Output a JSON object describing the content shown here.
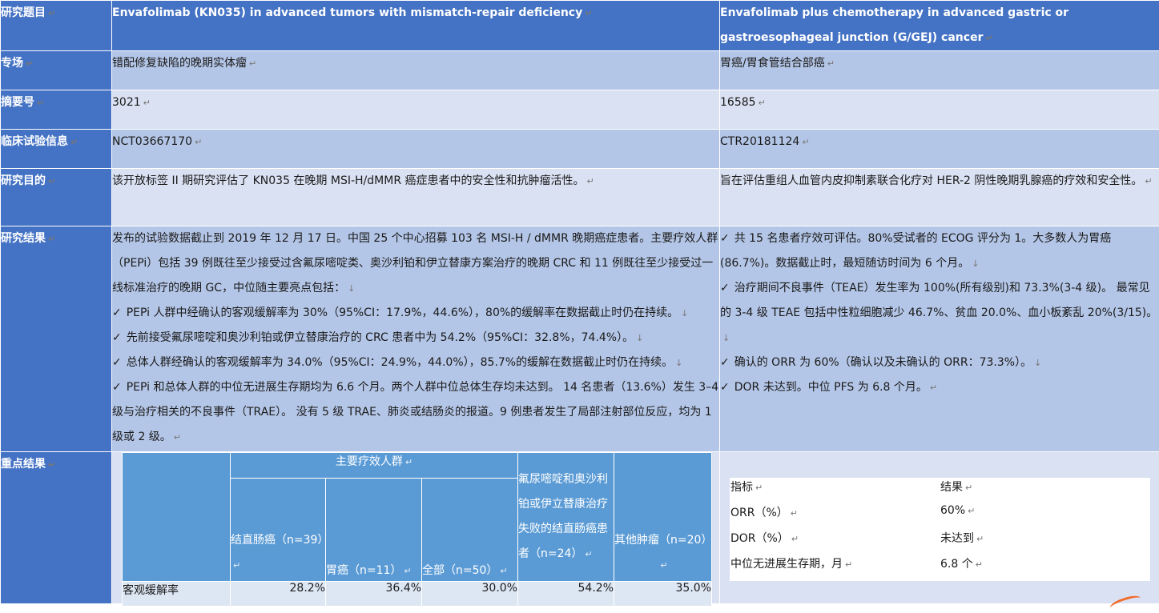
{
  "header": {
    "label": "研究题目",
    "col1": "Envafolimab (KN035) in advanced tumors with mismatch-repair deficiency",
    "col2": "Envafolimab plus chemotherapy in advanced gastric or gastroesophageal junction (G/GEJ) cancer"
  },
  "rows": {
    "specialty": {
      "label": "专场",
      "col1": "错配修复缺陷的晚期实体瘤",
      "col2": "胃癌/胃食管结合部癌"
    },
    "abstract_no": {
      "label": "摘要号",
      "col1": "3021",
      "col2": "16585"
    },
    "trial": {
      "label": "临床试验信息",
      "col1": "NCT03667170",
      "col2": "CTR20181124"
    },
    "purpose": {
      "label": "研究目的",
      "col1": "该开放标签 II 期研究评估了 KN035 在晚期 MSI-H/dMMR 癌症患者中的安全性和抗肿瘤活性。",
      "col2": "旨在评估重组人血管内皮抑制素联合化疗对 HER-2 阴性晚期乳腺癌的疗效和安全性。"
    },
    "results": {
      "label": "研究结果",
      "col1_intro": "发布的试验数据截止到 2019 年 12 月 17 日。中国 25 个中心招募 103 名 MSI-H / dMMR 晚期癌症患者。主要疗效人群（PEPi）包括 39 例既往至少接受过含氟尿嘧啶类、奥沙利铂和伊立替康方案治疗的晚期 CRC 和 11 例既往至少接受过一线标准治疗的晚期 GC，中位随主要亮点包括：",
      "col1_bullets": [
        "PEPi 人群中经确认的客观缓解率为 30%（95%CI：17.9%，44.6%），80%的缓解率在数据截止时仍在持续。",
        "先前接受氟尿嘧啶和奥沙利铂或伊立替康治疗的 CRC 患者中为 54.2%（95%CI：32.8%，74.4%）。",
        "总体人群经确认的客观缓解率为 34.0%（95%CI：24.9%，44.0%），85.7%的缓解在数据截止时仍在持续。",
        "PEPi 和总体人群的中位无进展生存期均为 6.6 个月。两个人群中位总体生存均未达到。 14 名患者（13.6%）发生 3–4 级与治疗相关的不良事件（TRAE）。 没有 5 级 TRAE、肺炎或结肠炎的报道。9 例患者发生了局部注射部位反应，均为 1 级或 2 级。"
      ],
      "col2_bullets": [
        "共 15 名患者疗效可评估。80%受试者的 ECOG 评分为 1。大多数人为胃癌(86.7%)。数据截止时，最短随访时间为 6 个月。",
        "治疗期间不良事件（TEAE）发生率为 100%(所有级别)和 73.3%(3-4 级)。 最常见的 3-4 级 TEAE 包括中性粒细胞减少 46.7%、贫血 20.0%、血小板紊乱 20%(3/15)。",
        "确认的 ORR 为 60%（确认以及未确认的 ORR：73.3%）。",
        "DOR 未达到。中位 PFS 为 6.8 个月。"
      ]
    },
    "key": {
      "label": "重点结果",
      "left_table": {
        "group_header": "主要疗效人群",
        "col_crc39": "结直肠癌（n=39）",
        "col_gc11": "胃癌（n=11）",
        "col_all50": "全部（n=50）",
        "col_crc24": "氟尿嘧啶和奥沙利铂或伊立替康治疗失败的结直肠癌患者（n=24）",
        "col_other20": "其他肿瘤（n=20）",
        "row_label": "客观缓解率",
        "row_values": [
          "28.2%",
          "36.4%",
          "30.0%",
          "54.2%",
          "35.0%"
        ]
      },
      "right_table": {
        "head": [
          "指标",
          "结果"
        ],
        "rows": [
          [
            "ORR（%）",
            "60%"
          ],
          [
            "DOR（%）",
            "未达到"
          ],
          [
            "中位无进展生存期，月",
            "6.8 个"
          ]
        ]
      }
    }
  }
}
